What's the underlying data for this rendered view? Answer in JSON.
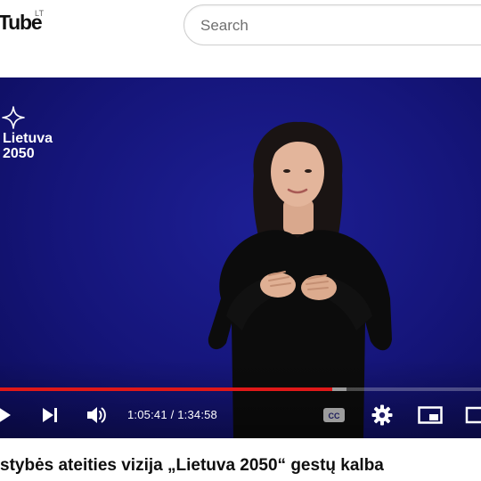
{
  "header": {
    "logo_text": "Tube",
    "region_code": "LT",
    "search": {
      "placeholder": "Search",
      "value": ""
    }
  },
  "player": {
    "overlay_brand": {
      "line1": "Lietuva",
      "line2": "2050"
    },
    "progress": {
      "played_fraction": 0.69,
      "buffered_fraction": 0.72
    },
    "current_time": "1:05:41",
    "duration": "1:34:58",
    "controls": [
      "play-icon",
      "next-icon",
      "volume-icon",
      "captions-icon",
      "settings-gear-icon",
      "miniplayer-icon",
      "theater-icon"
    ],
    "accent_color": "#e01818",
    "background_color": "#15157a"
  },
  "video": {
    "title": "stybės ateities vizija „Lietuva 2050“ gestų kalba"
  }
}
